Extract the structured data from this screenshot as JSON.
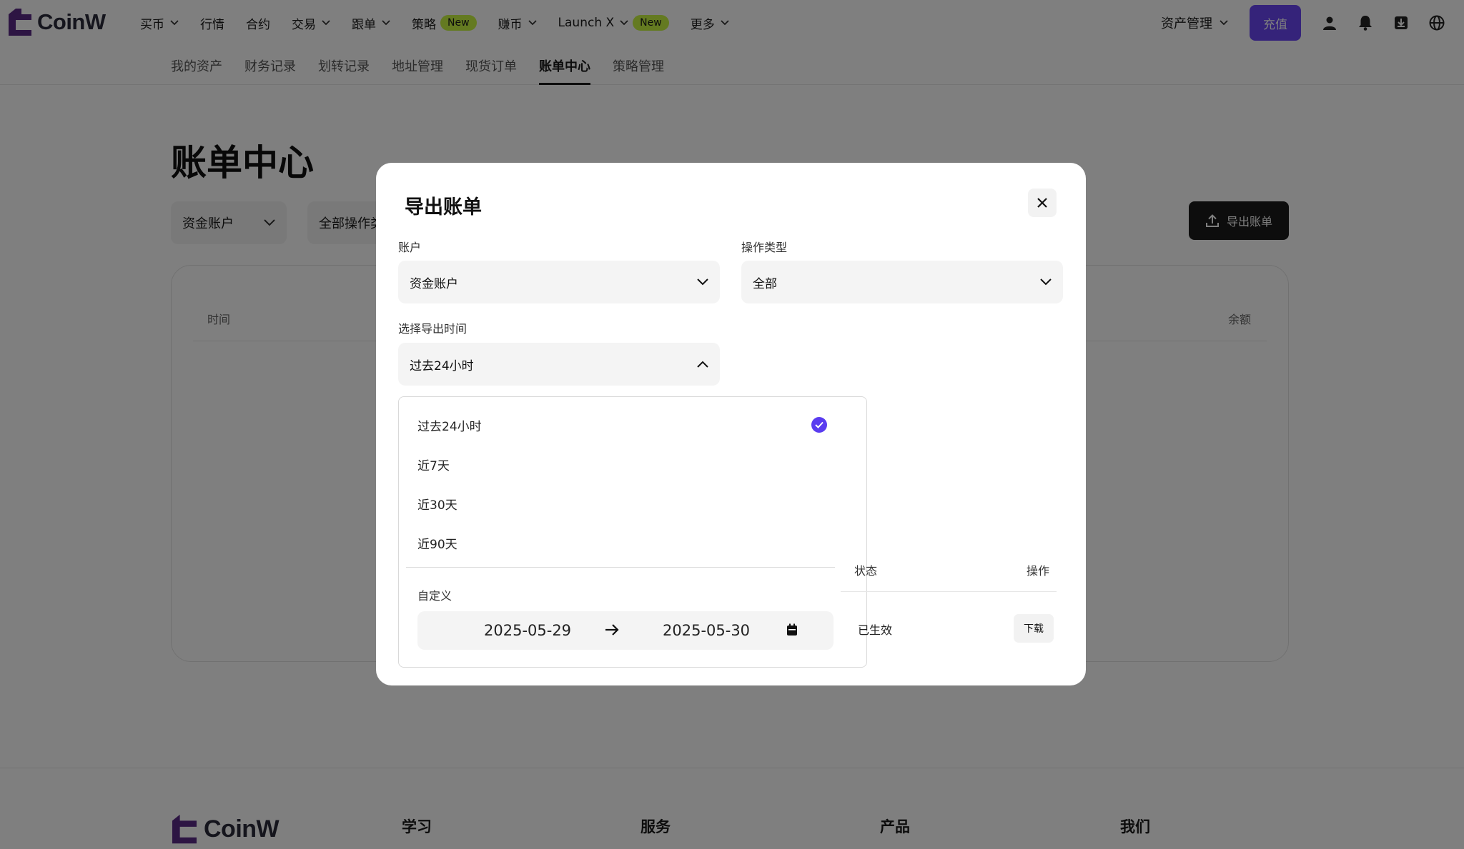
{
  "brand": {
    "name": "CoinW",
    "accent": "#6a47f5",
    "new_badge_color": "#c8f542"
  },
  "nav": {
    "items": [
      {
        "label": "买币",
        "has_dropdown": true
      },
      {
        "label": "行情",
        "has_dropdown": false
      },
      {
        "label": "合约",
        "has_dropdown": false
      },
      {
        "label": "交易",
        "has_dropdown": true
      },
      {
        "label": "跟单",
        "has_dropdown": true
      },
      {
        "label": "策略",
        "has_dropdown": false,
        "badge": "New"
      },
      {
        "label": "赚币",
        "has_dropdown": true
      },
      {
        "label": "Launch X",
        "has_dropdown": true,
        "badge": "New"
      },
      {
        "label": "更多",
        "has_dropdown": true
      }
    ],
    "asset_management": "资产管理",
    "recharge": "充值",
    "icons": [
      "user-icon",
      "bell-icon",
      "download-icon",
      "globe-icon"
    ]
  },
  "subnav": {
    "items": [
      "我的资产",
      "财务记录",
      "划转记录",
      "地址管理",
      "现货订单",
      "账单中心",
      "策略管理"
    ],
    "active": "账单中心"
  },
  "page": {
    "title": "账单中心",
    "filter_account": "资金账户",
    "filter_operation": "全部操作类型",
    "export_button": "导出账单",
    "table_headers": {
      "time": "时间",
      "balance": "余额"
    }
  },
  "footer": {
    "columns": [
      "学习",
      "服务",
      "产品",
      "我们"
    ]
  },
  "modal": {
    "title": "导出账单",
    "account_label": "账户",
    "account_value": "资金账户",
    "operation_label": "操作类型",
    "operation_value": "全部",
    "time_label": "选择导出时间",
    "time_value": "过去24小时",
    "time_options": [
      "过去24小时",
      "近7天",
      "近30天",
      "近90天"
    ],
    "selected_option": "过去24小时",
    "custom_label": "自定义",
    "date_start": "2025-05-29",
    "date_end": "2025-05-30",
    "table_headers": {
      "status": "状态",
      "operation": "操作"
    },
    "row": {
      "status": "已生效",
      "action": "下载"
    }
  }
}
